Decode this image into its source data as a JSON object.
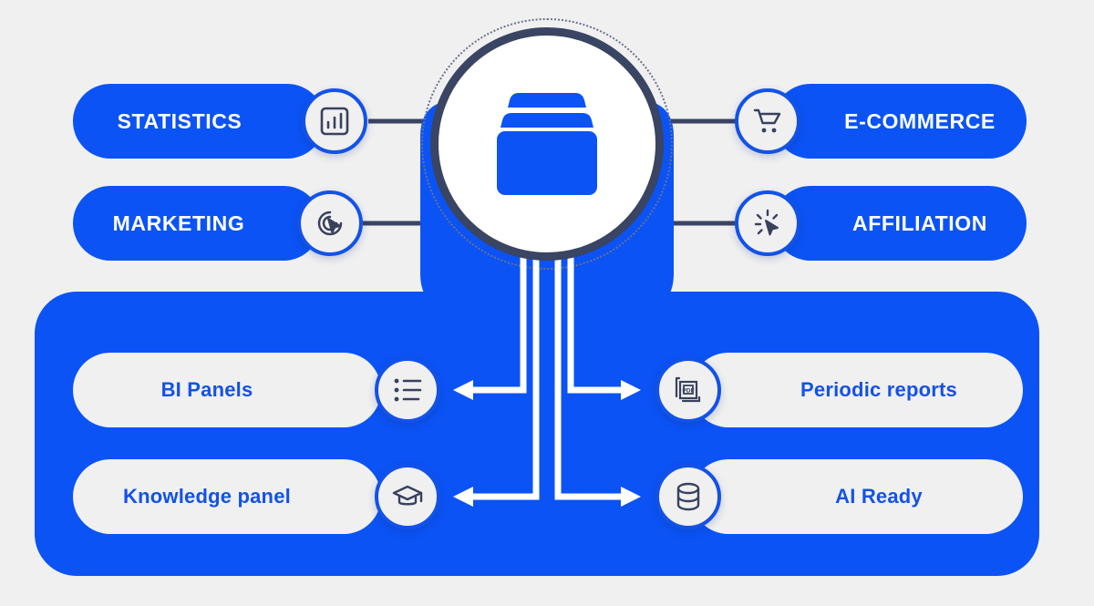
{
  "theme": {
    "background": "#f0f0f1",
    "brand_blue": "#0b53f5",
    "accent_blue": "#1352e8",
    "ink_navy": "#3a4463",
    "icon_navy": "#39415c",
    "pill_light": "#f0f0f1",
    "white": "#ffffff"
  },
  "hub": {
    "icon": "database-archive-icon",
    "ring_style": "dotted-orbit"
  },
  "sources": [
    {
      "id": "statistics",
      "label": "STATISTICS",
      "icon": "bar-chart-icon",
      "side": "left"
    },
    {
      "id": "marketing",
      "label": "MARKETING",
      "icon": "target-cursor-icon",
      "side": "left"
    },
    {
      "id": "ecommerce",
      "label": "E-COMMERCE",
      "icon": "shopping-cart-icon",
      "side": "right"
    },
    {
      "id": "affiliation",
      "label": "AFFILIATION",
      "icon": "click-burst-icon",
      "side": "right"
    }
  ],
  "outputs": [
    {
      "id": "bi-panels",
      "label": "BI Panels",
      "icon": "bullet-list-icon",
      "side": "left"
    },
    {
      "id": "knowledge-panel",
      "label": "Knowledge panel",
      "icon": "graduation-cap-icon",
      "side": "left"
    },
    {
      "id": "periodic-reports",
      "label": "Periodic reports",
      "icon": "pdf-documents-icon",
      "side": "right"
    },
    {
      "id": "ai-ready",
      "label": "AI Ready",
      "icon": "database-cylinder-icon",
      "side": "right"
    }
  ],
  "connectors": {
    "source_lines": 4,
    "output_arrows": 4,
    "arrow_color": "#ffffff",
    "source_line_color": "#3a4463"
  }
}
